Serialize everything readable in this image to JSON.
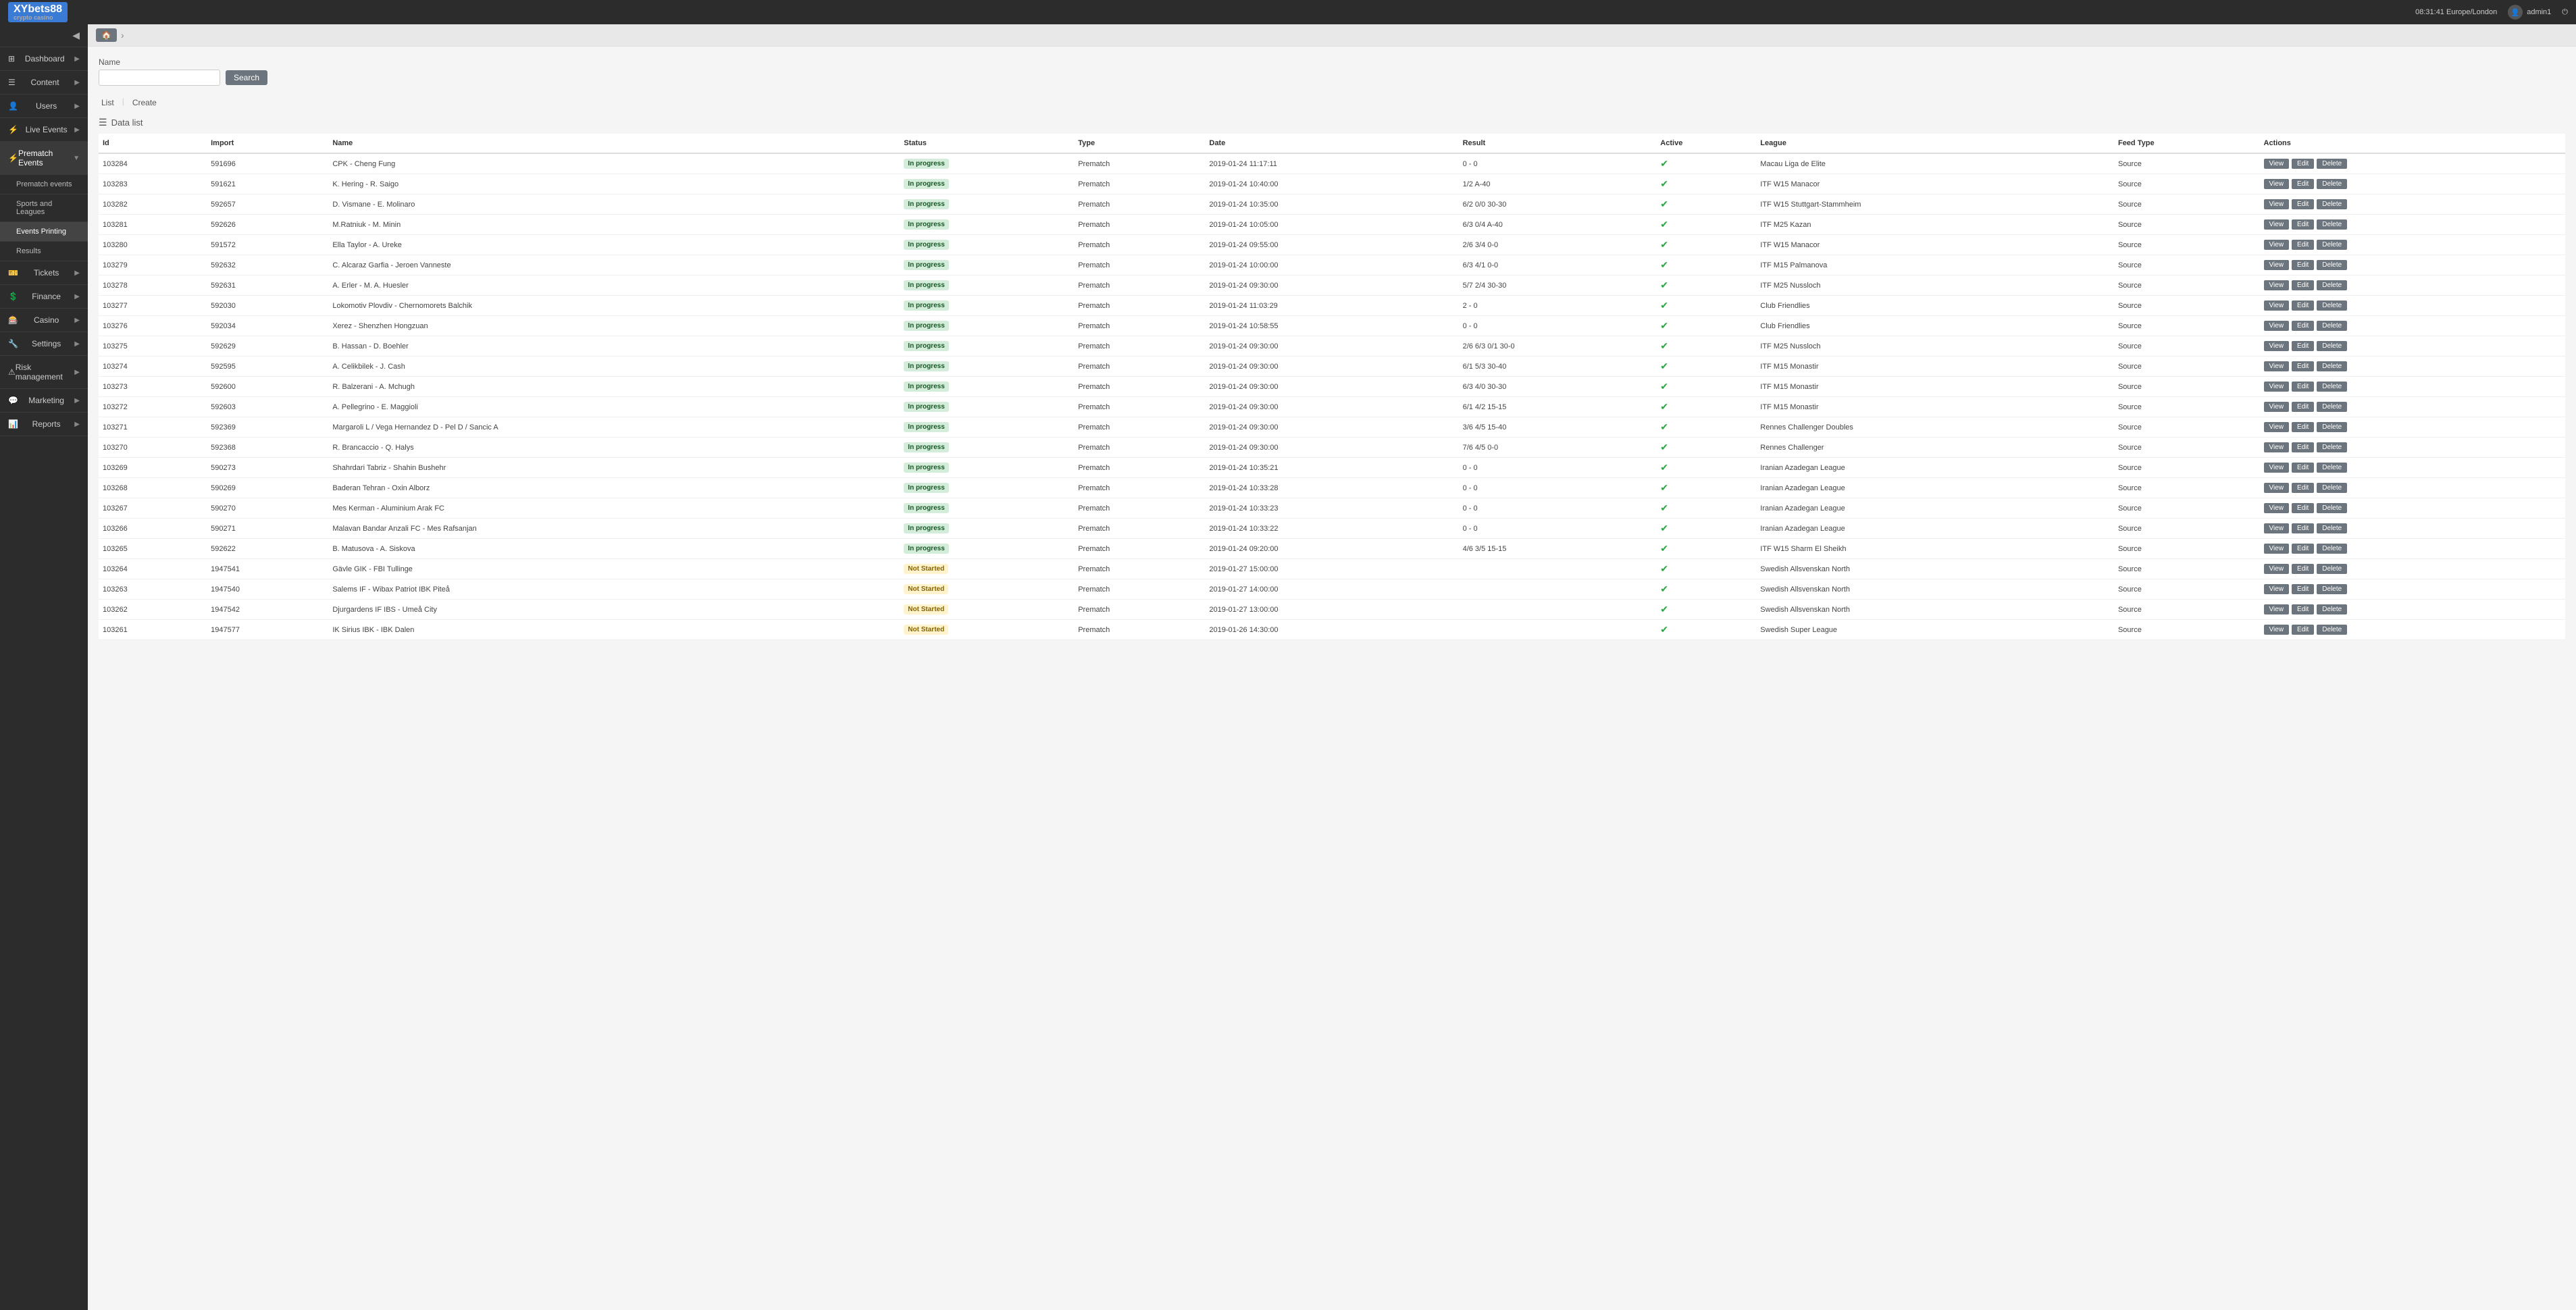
{
  "topbar": {
    "logo_text": "XYbets88",
    "logo_sub": "crypto casino",
    "datetime": "08:31:41 Europe/London",
    "username": "admin1"
  },
  "sidebar": {
    "items": [
      {
        "id": "dashboard",
        "label": "Dashboard",
        "icon": "⊞",
        "has_arrow": true
      },
      {
        "id": "content",
        "label": "Content",
        "icon": "☰",
        "has_arrow": true
      },
      {
        "id": "users",
        "label": "Users",
        "icon": "👤",
        "has_arrow": true
      },
      {
        "id": "live-events",
        "label": "Live Events",
        "icon": "⚡",
        "has_arrow": true
      },
      {
        "id": "prematch-events",
        "label": "Prematch Events",
        "icon": "⚡",
        "has_arrow": true,
        "active": true
      }
    ],
    "prematch_sub": [
      {
        "id": "prematch-events-sub",
        "label": "Prematch events",
        "active": false
      },
      {
        "id": "sports-leagues",
        "label": "Sports and Leagues",
        "active": false
      },
      {
        "id": "events-printing",
        "label": "Events Printing",
        "active": true
      },
      {
        "id": "results",
        "label": "Results",
        "active": false
      }
    ],
    "items_bottom": [
      {
        "id": "tickets",
        "label": "Tickets",
        "icon": "🎫",
        "has_arrow": true
      },
      {
        "id": "finance",
        "label": "Finance",
        "icon": "💲",
        "has_arrow": true
      },
      {
        "id": "casino",
        "label": "Casino",
        "icon": "🎰",
        "has_arrow": true
      },
      {
        "id": "settings",
        "label": "Settings",
        "icon": "🔧",
        "has_arrow": true
      },
      {
        "id": "risk-management",
        "label": "Risk management",
        "icon": "⚠",
        "has_arrow": true
      },
      {
        "id": "marketing",
        "label": "Marketing",
        "icon": "💬",
        "has_arrow": true
      },
      {
        "id": "reports",
        "label": "Reports",
        "icon": "📊",
        "has_arrow": true
      }
    ]
  },
  "breadcrumb": {
    "home_icon": "🏠"
  },
  "search": {
    "label": "Name",
    "placeholder": "",
    "button_label": "Search"
  },
  "actions": {
    "list_label": "List",
    "create_label": "Create"
  },
  "data_list": {
    "title": "Data list"
  },
  "table": {
    "columns": [
      "Id",
      "Import",
      "Name",
      "Status",
      "Type",
      "Date",
      "Result",
      "Active",
      "League",
      "Feed Type",
      "Actions"
    ],
    "rows": [
      {
        "id": "103284",
        "import": "591696",
        "name": "CPK - Cheng Fung",
        "status": "In progress",
        "type": "Prematch",
        "date": "2019-01-24 11:17:11",
        "result": "0 - 0",
        "active": true,
        "league": "Macau Liga de Elite",
        "feed_type": "Source"
      },
      {
        "id": "103283",
        "import": "591621",
        "name": "K. Hering - R. Saigo",
        "status": "In progress",
        "type": "Prematch",
        "date": "2019-01-24 10:40:00",
        "result": "1/2 A-40",
        "active": true,
        "league": "ITF W15 Manacor",
        "feed_type": "Source"
      },
      {
        "id": "103282",
        "import": "592657",
        "name": "D. Vismane - E. Molinaro",
        "status": "In progress",
        "type": "Prematch",
        "date": "2019-01-24 10:35:00",
        "result": "6/2 0/0 30-30",
        "active": true,
        "league": "ITF W15 Stuttgart-Stammheim",
        "feed_type": "Source"
      },
      {
        "id": "103281",
        "import": "592626",
        "name": "M.Ratniuk - M. Minin",
        "status": "In progress",
        "type": "Prematch",
        "date": "2019-01-24 10:05:00",
        "result": "6/3 0/4 A-40",
        "active": true,
        "league": "ITF M25 Kazan",
        "feed_type": "Source"
      },
      {
        "id": "103280",
        "import": "591572",
        "name": "Ella Taylor - A. Ureke",
        "status": "In progress",
        "type": "Prematch",
        "date": "2019-01-24 09:55:00",
        "result": "2/6 3/4 0-0",
        "active": true,
        "league": "ITF W15 Manacor",
        "feed_type": "Source"
      },
      {
        "id": "103279",
        "import": "592632",
        "name": "C. Alcaraz Garfia - Jeroen Vanneste",
        "status": "In progress",
        "type": "Prematch",
        "date": "2019-01-24 10:00:00",
        "result": "6/3 4/1 0-0",
        "active": true,
        "league": "ITF M15 Palmanova",
        "feed_type": "Source"
      },
      {
        "id": "103278",
        "import": "592631",
        "name": "A. Erler - M. A. Huesler",
        "status": "In progress",
        "type": "Prematch",
        "date": "2019-01-24 09:30:00",
        "result": "5/7 2/4 30-30",
        "active": true,
        "league": "ITF M25 Nussloch",
        "feed_type": "Source"
      },
      {
        "id": "103277",
        "import": "592030",
        "name": "Lokomotiv Plovdiv - Chernomorets Balchik",
        "status": "In progress",
        "type": "Prematch",
        "date": "2019-01-24 11:03:29",
        "result": "2 - 0",
        "active": true,
        "league": "Club Friendlies",
        "feed_type": "Source"
      },
      {
        "id": "103276",
        "import": "592034",
        "name": "Xerez - Shenzhen Hongzuan",
        "status": "In progress",
        "type": "Prematch",
        "date": "2019-01-24 10:58:55",
        "result": "0 - 0",
        "active": true,
        "league": "Club Friendlies",
        "feed_type": "Source"
      },
      {
        "id": "103275",
        "import": "592629",
        "name": "B. Hassan - D. Boehler",
        "status": "In progress",
        "type": "Prematch",
        "date": "2019-01-24 09:30:00",
        "result": "2/6 6/3 0/1 30-0",
        "active": true,
        "league": "ITF M25 Nussloch",
        "feed_type": "Source"
      },
      {
        "id": "103274",
        "import": "592595",
        "name": "A. Celikbilek - J. Cash",
        "status": "In progress",
        "type": "Prematch",
        "date": "2019-01-24 09:30:00",
        "result": "6/1 5/3 30-40",
        "active": true,
        "league": "ITF M15 Monastir",
        "feed_type": "Source"
      },
      {
        "id": "103273",
        "import": "592600",
        "name": "R. Balzerani - A. Mchugh",
        "status": "In progress",
        "type": "Prematch",
        "date": "2019-01-24 09:30:00",
        "result": "6/3 4/0 30-30",
        "active": true,
        "league": "ITF M15 Monastir",
        "feed_type": "Source"
      },
      {
        "id": "103272",
        "import": "592603",
        "name": "A. Pellegrino - E. Maggioli",
        "status": "In progress",
        "type": "Prematch",
        "date": "2019-01-24 09:30:00",
        "result": "6/1 4/2 15-15",
        "active": true,
        "league": "ITF M15 Monastir",
        "feed_type": "Source"
      },
      {
        "id": "103271",
        "import": "592369",
        "name": "Margaroli L / Vega Hernandez D - Pel D / Sancic A",
        "status": "In progress",
        "type": "Prematch",
        "date": "2019-01-24 09:30:00",
        "result": "3/6 4/5 15-40",
        "active": true,
        "league": "Rennes Challenger Doubles",
        "feed_type": "Source"
      },
      {
        "id": "103270",
        "import": "592368",
        "name": "R. Brancaccio - Q. Halys",
        "status": "In progress",
        "type": "Prematch",
        "date": "2019-01-24 09:30:00",
        "result": "7/6 4/5 0-0",
        "active": true,
        "league": "Rennes Challenger",
        "feed_type": "Source"
      },
      {
        "id": "103269",
        "import": "590273",
        "name": "Shahrdari Tabriz - Shahin Bushehr",
        "status": "In progress",
        "type": "Prematch",
        "date": "2019-01-24 10:35:21",
        "result": "0 - 0",
        "active": true,
        "league": "Iranian Azadegan League",
        "feed_type": "Source"
      },
      {
        "id": "103268",
        "import": "590269",
        "name": "Baderan Tehran - Oxin Alborz",
        "status": "In progress",
        "type": "Prematch",
        "date": "2019-01-24 10:33:28",
        "result": "0 - 0",
        "active": true,
        "league": "Iranian Azadegan League",
        "feed_type": "Source"
      },
      {
        "id": "103267",
        "import": "590270",
        "name": "Mes Kerman - Aluminium Arak FC",
        "status": "In progress",
        "type": "Prematch",
        "date": "2019-01-24 10:33:23",
        "result": "0 - 0",
        "active": true,
        "league": "Iranian Azadegan League",
        "feed_type": "Source"
      },
      {
        "id": "103266",
        "import": "590271",
        "name": "Malavan Bandar Anzali FC - Mes Rafsanjan",
        "status": "In progress",
        "type": "Prematch",
        "date": "2019-01-24 10:33:22",
        "result": "0 - 0",
        "active": true,
        "league": "Iranian Azadegan League",
        "feed_type": "Source"
      },
      {
        "id": "103265",
        "import": "592622",
        "name": "B. Matusova - A. Siskova",
        "status": "In progress",
        "type": "Prematch",
        "date": "2019-01-24 09:20:00",
        "result": "4/6 3/5 15-15",
        "active": true,
        "league": "ITF W15 Sharm El Sheikh",
        "feed_type": "Source"
      },
      {
        "id": "103264",
        "import": "1947541",
        "name": "Gävle GIK - FBI Tullinge",
        "status": "Not Started",
        "type": "Prematch",
        "date": "2019-01-27 15:00:00",
        "result": "",
        "active": true,
        "league": "Swedish Allsvenskan North",
        "feed_type": "Source"
      },
      {
        "id": "103263",
        "import": "1947540",
        "name": "Salems IF - Wibax Patriot IBK Piteå",
        "status": "Not Started",
        "type": "Prematch",
        "date": "2019-01-27 14:00:00",
        "result": "",
        "active": true,
        "league": "Swedish Allsvenskan North",
        "feed_type": "Source"
      },
      {
        "id": "103262",
        "import": "1947542",
        "name": "Djurgardens IF IBS - Umeå City",
        "status": "Not Started",
        "type": "Prematch",
        "date": "2019-01-27 13:00:00",
        "result": "",
        "active": true,
        "league": "Swedish Allsvenskan North",
        "feed_type": "Source"
      },
      {
        "id": "103261",
        "import": "1947577",
        "name": "IK Sirius IBK - IBK Dalen",
        "status": "Not Started",
        "type": "Prematch",
        "date": "2019-01-26 14:30:00",
        "result": "",
        "active": true,
        "league": "Swedish Super League",
        "feed_type": "Source"
      }
    ]
  },
  "buttons": {
    "view": "View",
    "edit": "Edit",
    "delete": "Delete"
  }
}
